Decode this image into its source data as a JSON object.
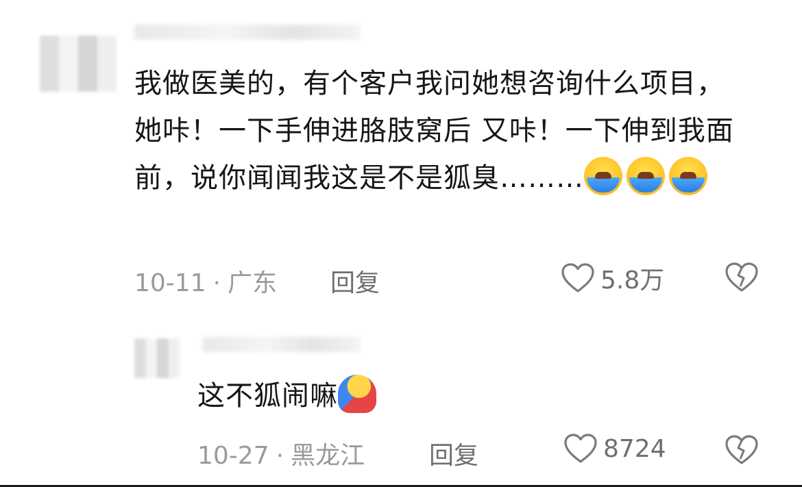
{
  "comment": {
    "text": "我做医美的，有个客户我问她想咨询什么项目，她咔！一下手伸进胳肢窝后 又咔！一下伸到我面前，说你闻闻我这是不是狐臭………",
    "emojis": [
      "loudly-crying-face",
      "loudly-crying-face",
      "loudly-crying-face"
    ],
    "date": "10-11",
    "separator": "·",
    "location": "广东",
    "reply_label": "回复",
    "like_count": "5.8万"
  },
  "reply": {
    "text": "这不狐闹嘛",
    "emojis": [
      "hugging-face"
    ],
    "date": "10-27",
    "separator": "·",
    "location": "黑龙江",
    "reply_label": "回复",
    "like_count": "8724"
  },
  "colors": {
    "text": "#161616",
    "meta": "#9a9a9a",
    "action": "#6f6f6f"
  }
}
